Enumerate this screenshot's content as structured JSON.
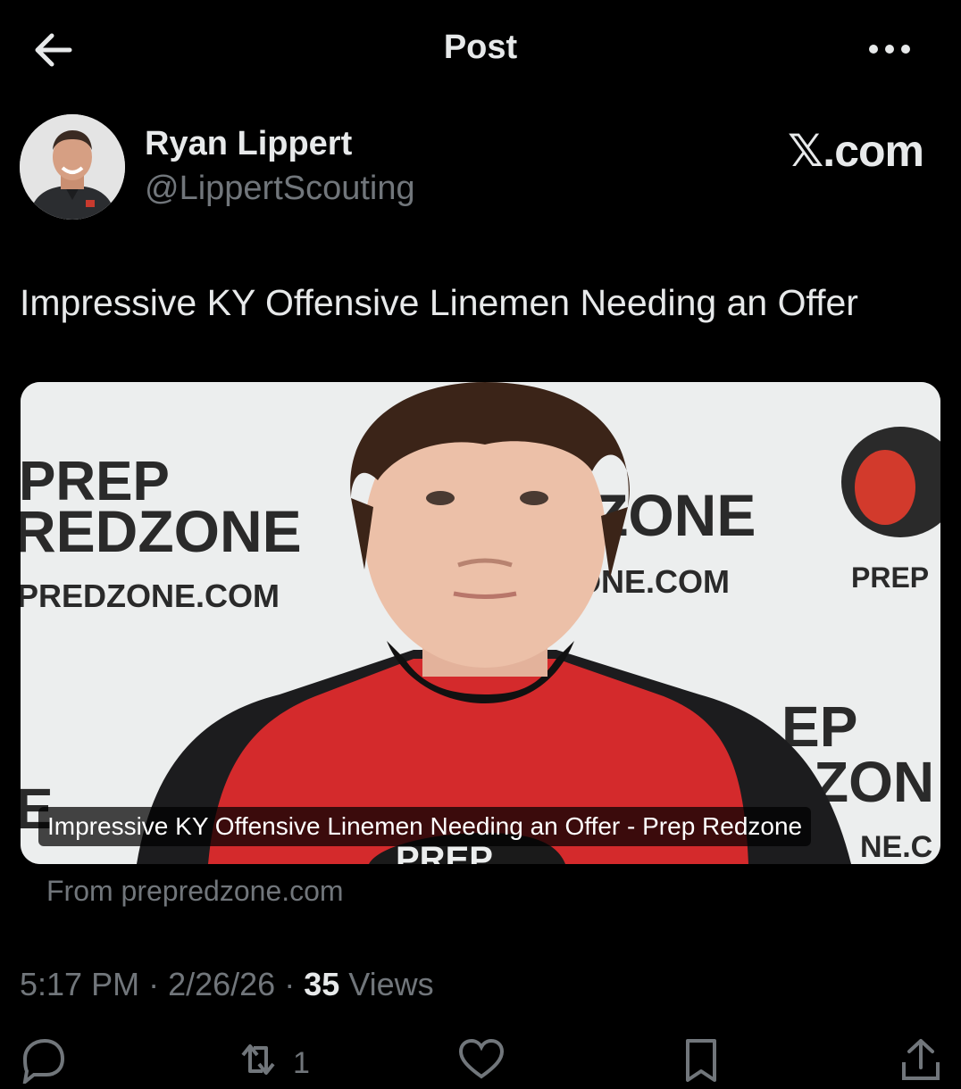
{
  "header": {
    "title": "Post",
    "back_icon": "arrow-left-icon",
    "more_icon": "more-horizontal-icon"
  },
  "author": {
    "name": "Ryan Lippert",
    "handle": "@LippertScouting",
    "badge": "𝕏.com"
  },
  "post": {
    "text": "Impressive KY Offensive Linemen Needing an Offer"
  },
  "card": {
    "caption": "Impressive KY Offensive Linemen Needing an Offer - Prep Redzone",
    "source": "From prepredzone.com",
    "backdrop": {
      "left_line1": "PREP",
      "left_line2": "REDZONE",
      "left_url": "PREDZONE.COM",
      "center_line2": "ZONE",
      "center_url": "ZONE.COM",
      "right_small": "PREP",
      "bottom_right_line1": "EP",
      "bottom_right_line2": "ZON",
      "bottom_right_url": "NE.C",
      "bottom_left": "E",
      "shirt": "PREP"
    },
    "colors": {
      "shirt": "#d42a2c",
      "backdrop": "#eceeee",
      "logo_red": "#d23a2c"
    }
  },
  "meta": {
    "time": "5:17 PM",
    "sep1": " · ",
    "date": "2/26/26",
    "sep2": " · ",
    "views_count": "35",
    "views_label": " Views"
  },
  "actions": {
    "reply_icon": "reply-icon",
    "repost_icon": "repost-icon",
    "repost_count": "1",
    "like_icon": "heart-icon",
    "bookmark_icon": "bookmark-icon",
    "share_icon": "share-icon"
  }
}
